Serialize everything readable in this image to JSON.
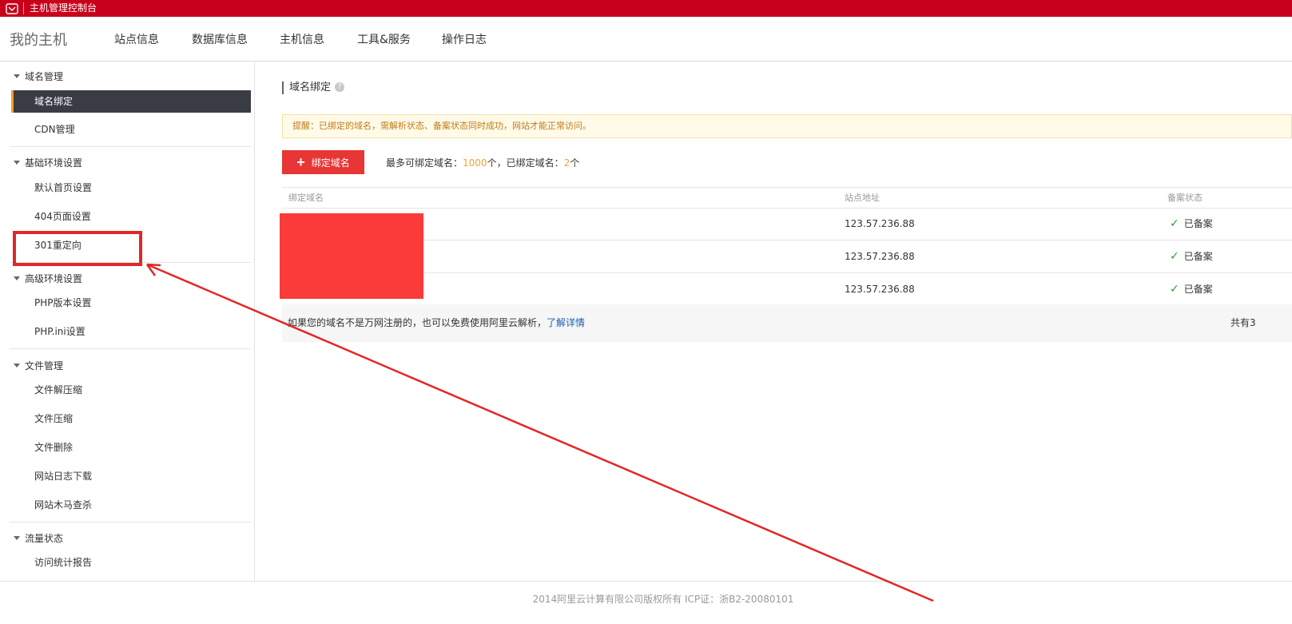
{
  "app": {
    "title": "主机管理控制台"
  },
  "header": {
    "brand": "我的主机",
    "nav": [
      "站点信息",
      "数据库信息",
      "主机信息",
      "工具&服务",
      "操作日志"
    ]
  },
  "sidebar": {
    "groups": [
      {
        "title": "域名管理",
        "items": [
          "域名绑定",
          "CDN管理"
        ]
      },
      {
        "title": "基础环境设置",
        "items": [
          "默认首页设置",
          "404页面设置",
          "301重定向"
        ]
      },
      {
        "title": "高级环境设置",
        "items": [
          "PHP版本设置",
          "PHP.ini设置"
        ]
      },
      {
        "title": "文件管理",
        "items": [
          "文件解压缩",
          "文件压缩",
          "文件删除",
          "网站日志下载",
          "网站木马查杀"
        ]
      },
      {
        "title": "流量状态",
        "items": [
          "访问统计报告"
        ]
      }
    ],
    "active_item": "域名绑定"
  },
  "main": {
    "section_title": "域名绑定",
    "help_icon": "question-icon",
    "notice": "提醒：已绑定的域名，需解析状态、备案状态同时成功，网站才能正常访问。",
    "bind_button": "绑定域名",
    "quota": {
      "max_label": "最多可绑定域名：",
      "max_value": "1000",
      "max_unit": "个，已绑定域名：",
      "bound_value": "2",
      "bound_unit": "个"
    },
    "table": {
      "headers": [
        "绑定域名",
        "站点地址",
        "备案状态"
      ],
      "rows": [
        {
          "domain": "",
          "address": "123.57.236.88",
          "status": "已备案"
        },
        {
          "domain": "",
          "address": "123.57.236.88",
          "status": "已备案"
        },
        {
          "domain": "",
          "address": "123.57.236.88",
          "status": "已备案"
        }
      ],
      "footer_text": "如果您的域名不是万网注册的，也可以免费使用阿里云解析，",
      "footer_link": "了解详情",
      "footer_right": "共有3"
    }
  },
  "footer": {
    "copyright": "2014阿里云计算有限公司版权所有 ICP证：浙B2-20080101"
  },
  "colors": {
    "topbar": "#c9001b",
    "active_bg": "#3a3c45",
    "active_accent": "#f49c26",
    "primary_button": "#e83535",
    "annotation": "#e02828"
  }
}
